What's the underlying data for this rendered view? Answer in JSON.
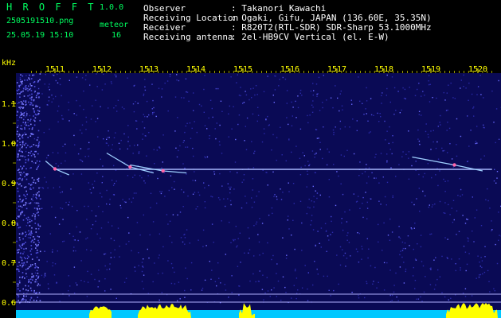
{
  "header": {
    "app_name": "H R O F F T",
    "version": "1.0.0",
    "file_name": "2505191510.png",
    "event_label": "meteor",
    "timestamp": "25.05.19 15:10",
    "meteor_count": "16",
    "info": [
      {
        "key": "Observer",
        "value": ": Takanori Kawachi"
      },
      {
        "key": "Receiving Location",
        "value": ": Ogaki, Gifu, JAPAN (136.60E, 35.35N)"
      },
      {
        "key": "Receiver",
        "value": ": R820T2(RTL-SDR) SDR-Sharp 53.1000MHz"
      },
      {
        "key": "Receiving antenna",
        "value": ": 2el-HB9CV Vertical (el. E-W)"
      }
    ]
  },
  "chart_data": {
    "type": "heatmap",
    "ylabel": "kHz",
    "x_ticks": [
      "1511",
      "1512",
      "1513",
      "1514",
      "1515",
      "1516",
      "1517",
      "1518",
      "1519",
      "1520"
    ],
    "y_ticks": [
      "1.1",
      "1.0",
      "0.9",
      "0.8",
      "0.7",
      "0.6"
    ],
    "x_range": [
      1510.5,
      1520.3
    ],
    "y_range": [
      0.58,
      1.19
    ],
    "carrier_khz": 0.934,
    "traces": [
      {
        "x": [
          1510.8,
          1511.0,
          1511.3
        ],
        "y": [
          0.955,
          0.935,
          0.92
        ]
      },
      {
        "x": [
          1512.1,
          1512.6,
          1513.1
        ],
        "y": [
          0.975,
          0.94,
          0.925
        ]
      },
      {
        "x": [
          1512.6,
          1513.3,
          1513.8
        ],
        "y": [
          0.945,
          0.93,
          0.925
        ]
      },
      {
        "x": [
          1518.6,
          1519.5,
          1520.1
        ],
        "y": [
          0.965,
          0.945,
          0.93
        ]
      }
    ],
    "colors": {
      "background": "#0a0a55",
      "carrier": "#a8b8ff",
      "bars": "#ffff00",
      "base": "#00c8ff"
    }
  }
}
